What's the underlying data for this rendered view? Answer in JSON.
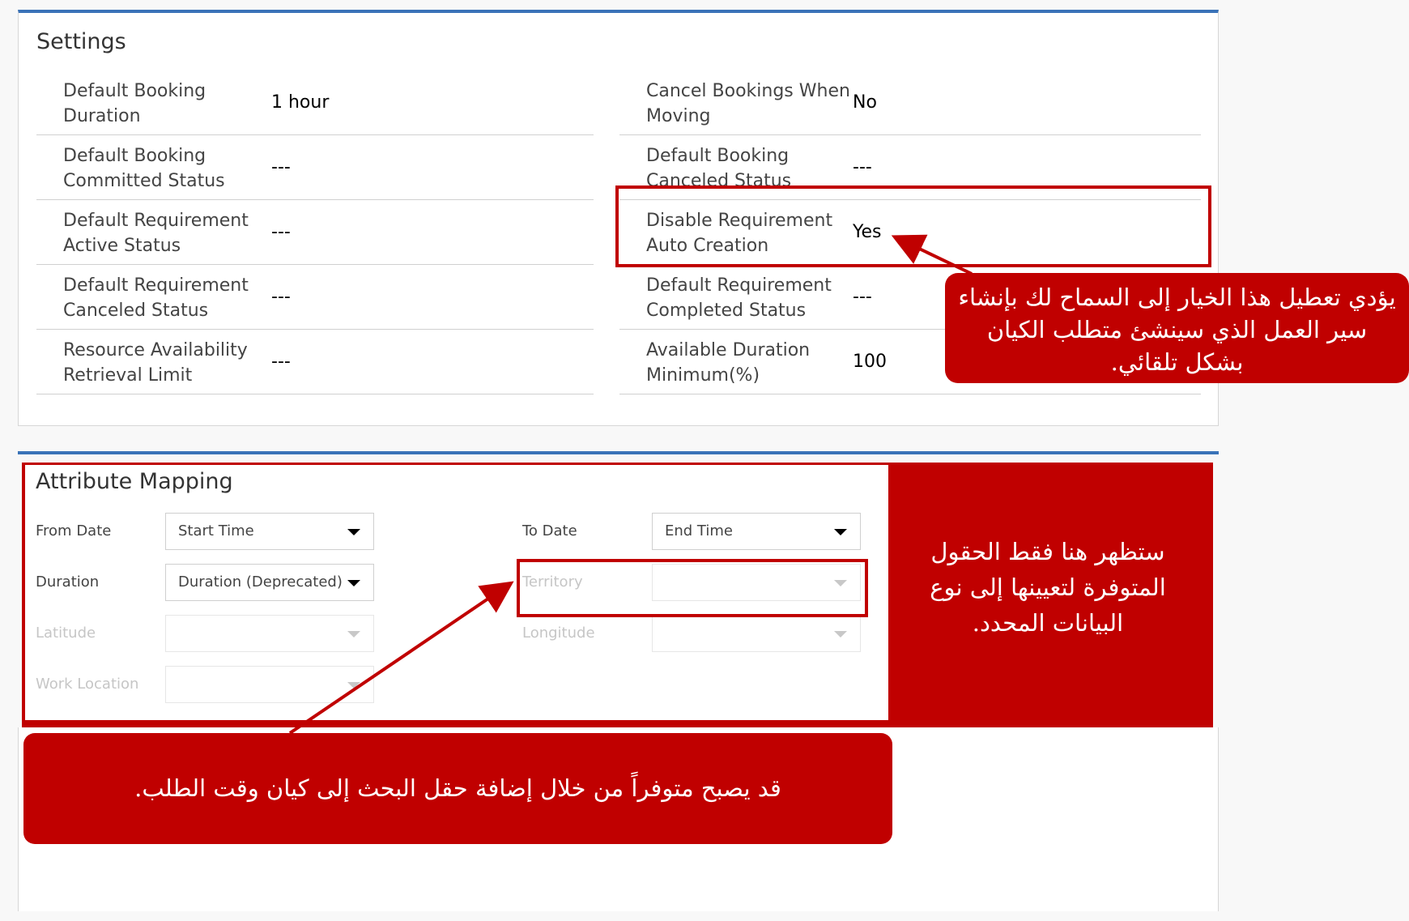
{
  "settings": {
    "title": "Settings",
    "left_fields": [
      {
        "label": "Default Booking Duration",
        "value": "1 hour"
      },
      {
        "label": "Default Booking Committed Status",
        "value": "---"
      },
      {
        "label": "Default Requirement Active Status",
        "value": "---"
      },
      {
        "label": "Default Requirement Canceled Status",
        "value": "---"
      },
      {
        "label": "Resource Availability Retrieval Limit",
        "value": "---"
      }
    ],
    "right_fields": [
      {
        "label": "Cancel Bookings When Moving",
        "value": "No"
      },
      {
        "label": "Default Booking Canceled Status",
        "value": "---"
      },
      {
        "label": "Disable Requirement Auto Creation",
        "value": "Yes"
      },
      {
        "label": "Default Requirement Completed Status",
        "value": "---"
      },
      {
        "label": "Available Duration Minimum(%)",
        "value": "100"
      }
    ]
  },
  "attribute_mapping": {
    "title": "Attribute Mapping",
    "from_date": {
      "label": "From Date",
      "value": "Start Time"
    },
    "to_date": {
      "label": "To Date",
      "value": "End Time"
    },
    "duration": {
      "label": "Duration",
      "value": "Duration (Deprecated)"
    },
    "territory": {
      "label": "Territory",
      "value": ""
    },
    "latitude": {
      "label": "Latitude",
      "value": ""
    },
    "longitude": {
      "label": "Longitude",
      "value": ""
    },
    "work_location": {
      "label": "Work Location",
      "value": ""
    }
  },
  "callouts": {
    "disable_auto_creation": "يؤدي تعطيل هذا الخيار إلى السماح لك بإنشاء سير العمل الذي سينشئ متطلب الكيان بشكل تلقائي.",
    "available_fields": "ستظهر هنا فقط الحقول المتوفرة لتعيينها إلى نوع البيانات المحدد.",
    "lookup_field": "قد يصبح متوفراً من خلال إضافة حقل البحث إلى كيان وقت الطلب."
  },
  "colors": {
    "accent_bar": "#3a73b8",
    "callout_red": "#c00000"
  }
}
